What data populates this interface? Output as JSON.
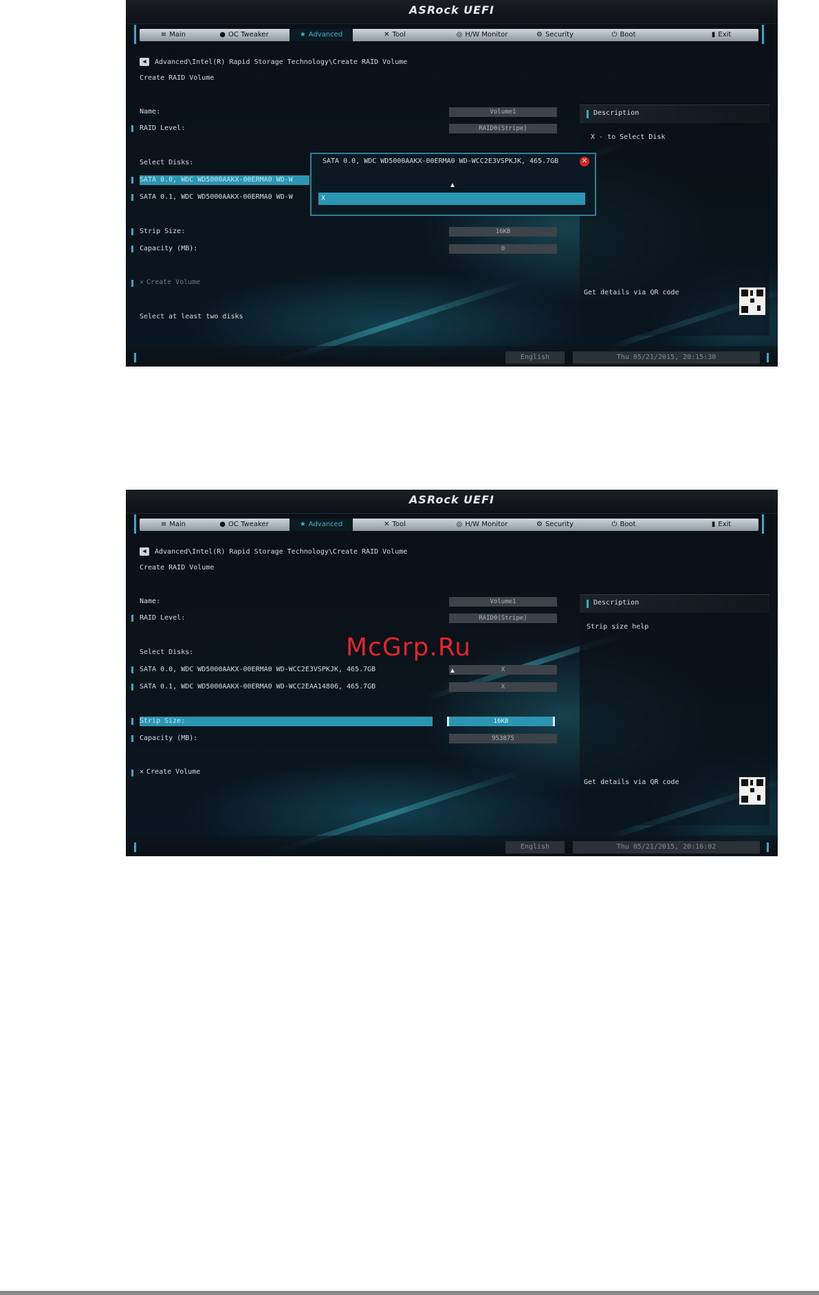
{
  "brand": "ASRock UEFI",
  "nav": {
    "tabs": [
      {
        "label": "Main",
        "icon": "list-icon"
      },
      {
        "label": "OC Tweaker",
        "icon": "person-icon"
      },
      {
        "label": "Advanced",
        "icon": "star-icon"
      },
      {
        "label": "Tool",
        "icon": "tool-icon"
      },
      {
        "label": "H/W Monitor",
        "icon": "monitor-icon"
      },
      {
        "label": "Security",
        "icon": "shield-icon"
      },
      {
        "label": "Boot",
        "icon": "power-icon"
      },
      {
        "label": "Exit",
        "icon": "exit-icon"
      }
    ],
    "active": "Advanced"
  },
  "screen1": {
    "breadcrumb": "Advanced\\Intel(R) Rapid Storage Technology\\Create RAID Volume",
    "subtitle": "Create RAID Volume",
    "name_label": "Name:",
    "name_value": "Volume1",
    "raid_label": "RAID Level:",
    "raid_value": "RAID0(Stripe)",
    "select_disks": "Select Disks:",
    "disk1": "SATA 0.0, WDC WD5000AAKX-00ERMA0 WD-W",
    "disk2": "SATA 0.1, WDC WD5000AAKX-00ERMA0 WD-W",
    "strip_label": "Strip Size:",
    "strip_value": "16KB",
    "capacity_label": "Capacity (MB):",
    "capacity_value": "0",
    "create": "Create Volume",
    "hint": "Select at least two disks",
    "description_title": "Description",
    "description_text": "X - to Select Disk",
    "qr_text": "Get details via QR code",
    "popup_title": "SATA 0.0, WDC WD5000AAKX-00ERMA0 WD-WCC2E3VSPKJK, 465.7GB",
    "popup_option": "X",
    "language": "English",
    "datetime": "Thu 05/21/2015, 20:15:30"
  },
  "screen2": {
    "breadcrumb": "Advanced\\Intel(R) Rapid Storage Technology\\Create RAID Volume",
    "subtitle": "Create RAID Volume",
    "name_label": "Name:",
    "name_value": "Volume1",
    "raid_label": "RAID Level:",
    "raid_value": "RAID0(Stripe)",
    "select_disks": "Select Disks:",
    "disk1": "SATA 0.0, WDC WD5000AAKX-00ERMA0 WD-WCC2E3VSPKJK, 465.7GB",
    "disk1_value": "X",
    "disk2": "SATA 0.1, WDC WD5000AAKX-00ERMA0 WD-WCC2EAA14806, 465.7GB",
    "disk2_value": "X",
    "strip_label": "Strip Size:",
    "strip_value": "16KB",
    "capacity_label": "Capacity (MB):",
    "capacity_value": "953875",
    "create": "Create Volume",
    "description_title": "Description",
    "description_text": "Strip size help",
    "qr_text": "Get details via QR code",
    "language": "English",
    "datetime": "Thu 05/21/2015, 20:16:02"
  },
  "watermark": "McGrp.Ru",
  "colors": {
    "accent": "#2b95b2",
    "close": "#d9232b",
    "watermark": "#e1252b"
  }
}
